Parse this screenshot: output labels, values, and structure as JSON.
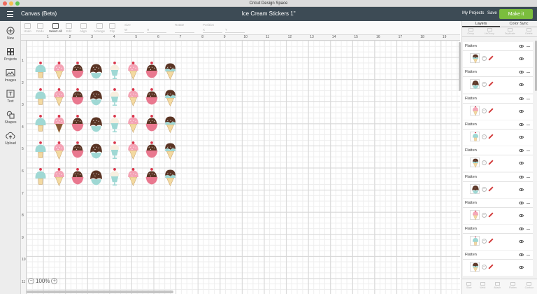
{
  "window": {
    "title": "Cricut Design Space"
  },
  "header": {
    "app_title": "Canvas (Beta)",
    "doc_title": "Ice Cream Stickers 1\"",
    "my_projects": "My Projects",
    "save": "Save",
    "make_it": "Make it"
  },
  "toolbar": {
    "undo": "Undo",
    "redo": "Redo",
    "select_all": "Select All",
    "edit": "Edit",
    "align": "Align",
    "arrange": "Arrange",
    "flip": "Flip",
    "size": "Size",
    "rotate": "Rotate",
    "position": "Position",
    "w": "W",
    "h": "H",
    "x": "X",
    "y": "Y"
  },
  "sidebar": {
    "items": [
      {
        "label": "New",
        "icon": "plus-icon"
      },
      {
        "label": "Projects",
        "icon": "grid-icon"
      },
      {
        "label": "Images",
        "icon": "image-icon"
      },
      {
        "label": "Text",
        "icon": "text-icon"
      },
      {
        "label": "Shapes",
        "icon": "shapes-icon"
      },
      {
        "label": "Upload",
        "icon": "upload-icon"
      }
    ]
  },
  "canvas": {
    "ruler_top": [
      "1",
      "2",
      "3",
      "4",
      "5",
      "6",
      "7",
      "8",
      "9",
      "10",
      "11",
      "12",
      "13",
      "14",
      "15",
      "16",
      "17",
      "18",
      "19",
      "20"
    ],
    "ruler_left": [
      "1",
      "2",
      "3",
      "4",
      "5",
      "6",
      "7",
      "8",
      "9",
      "10",
      "11"
    ],
    "zoom": "100%",
    "sticker_rows": [
      [
        "blue-cone",
        "pink-cone",
        "pink-bowl",
        "choc-sundae",
        "float-glass",
        "pink-cone",
        "pink-bowl",
        "choc-cone"
      ],
      [
        "blue-cone",
        "pink-cone",
        "pink-bowl",
        "choc-sundae",
        "float-glass",
        "pink-cone",
        "pink-bowl",
        "choc-cone"
      ],
      [
        "blue-cone",
        "choc-pink-cone",
        "pink-bowl",
        "choc-sundae",
        "float-glass",
        "pink-cone",
        "pink-bowl",
        "choc-cone"
      ],
      [
        "blue-cone",
        "pink-cone",
        "pink-bowl",
        "choc-sundae",
        "float-glass",
        "pink-cone",
        "pink-bowl",
        "choc-cone"
      ],
      [
        "blue-cone",
        "pink-cone",
        "pink-bowl",
        "choc-sundae",
        "float-glass",
        "pink-cone",
        "pink-bowl",
        "choc-cone"
      ]
    ]
  },
  "right_panel": {
    "tabs": [
      "Layers",
      "Color Sync"
    ],
    "tools": [
      "Group",
      "UnGroup",
      "Duplicate",
      "Delete"
    ],
    "layers": [
      {
        "name": "Flatten",
        "thumb": "choc-cone"
      },
      {
        "name": "Flatten",
        "thumb": "choc-sundae"
      },
      {
        "name": "Flatten",
        "thumb": "pink-cone"
      },
      {
        "name": "Flatten",
        "thumb": "blue-cone"
      },
      {
        "name": "Flatten",
        "thumb": "choc-cone"
      },
      {
        "name": "Flatten",
        "thumb": "choc-sundae"
      },
      {
        "name": "Flatten",
        "thumb": "pink-cone"
      },
      {
        "name": "Flatten",
        "thumb": "blue-cone"
      },
      {
        "name": "Flatten",
        "thumb": "choc-cone"
      }
    ],
    "bottom_tools": [
      "Slice",
      "Weld",
      "Attach",
      "Flatten",
      "Contour"
    ]
  },
  "colors": {
    "header": "#3d4b55",
    "make_it": "#7bbd3d",
    "pink": "#f4a3b5",
    "pink_dark": "#e9788f",
    "mint": "#9fd8d4",
    "chocolate": "#5a3424",
    "cone": "#f3d9a0",
    "cherry": "#d9354a"
  }
}
